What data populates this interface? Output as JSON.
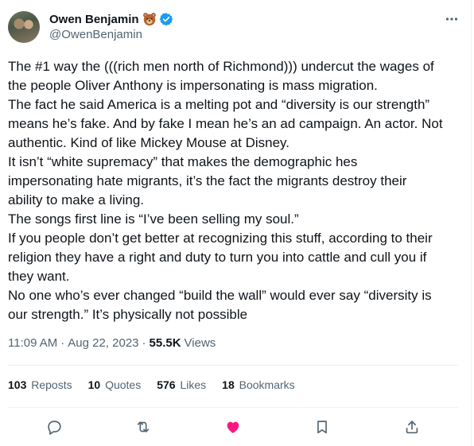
{
  "author": {
    "display_name": "Owen Benjamin",
    "handle": "@OwenBenjamin",
    "emoji_icon": "bear-face-icon",
    "verified_icon": "verified-badge-icon",
    "verified_color": "#1d9bf0"
  },
  "tweet": {
    "lines": [
      "The #1 way the (((rich men north of Richmond))) undercut the wages of",
      "the people Oliver Anthony is impersonating is mass migration.",
      "The fact he said America is a melting pot and “diversity is our strength”",
      "means he’s fake. And by fake I mean he’s an ad campaign. An actor. Not",
      "authentic. Kind of like Mickey Mouse at Disney.",
      "It isn’t “white supremacy” that makes the demographic hes",
      "impersonating hate migrants, it’s the fact the migrants destroy their",
      "ability to make a living.",
      "The songs first line is “I’ve been selling my soul.”",
      "If you people don’t get better at recognizing this stuff, according to their",
      "religion they have a right and duty to turn you into cattle and cull you if",
      "they want.",
      "No one who’s ever changed “build the wall” would ever say “diversity is",
      "our strength.” It’s physically not possible"
    ]
  },
  "meta": {
    "time": "11:09 AM",
    "date": "Aug 22, 2023",
    "views_count": "55.5K",
    "views_label": "Views"
  },
  "stats": {
    "reposts": {
      "count": "103",
      "label": "Reposts"
    },
    "quotes": {
      "count": "10",
      "label": "Quotes"
    },
    "likes": {
      "count": "576",
      "label": "Likes"
    },
    "bookmarks": {
      "count": "18",
      "label": "Bookmarks"
    }
  },
  "actions": {
    "reply_icon": "reply-icon",
    "repost_icon": "repost-icon",
    "like_icon": "heart-filled-icon",
    "like_color": "#f91880",
    "bookmark_icon": "bookmark-icon",
    "share_icon": "share-icon",
    "icon_color": "#536471"
  }
}
